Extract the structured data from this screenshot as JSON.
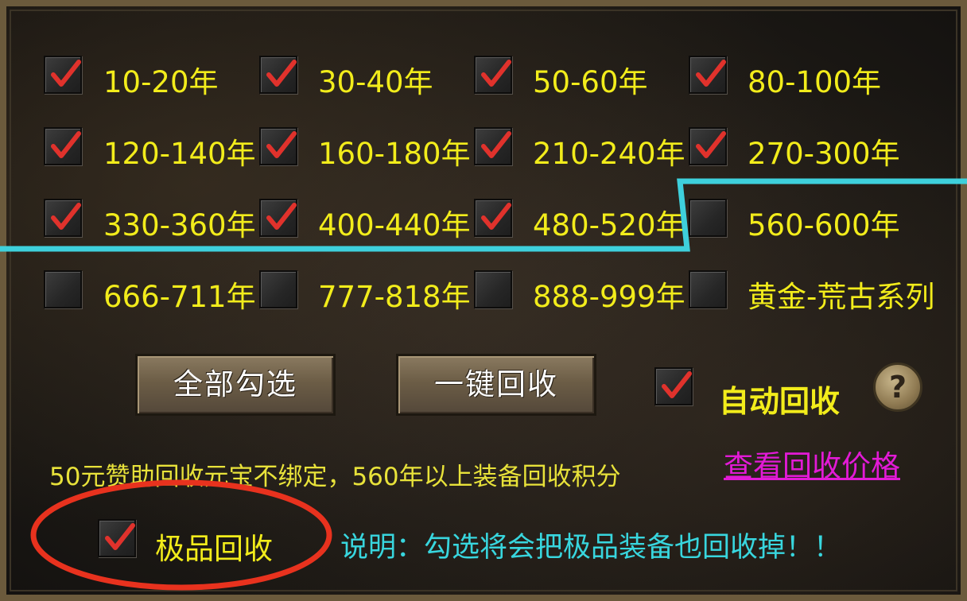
{
  "ranges": [
    {
      "label": "10-20年",
      "checked": true
    },
    {
      "label": "30-40年",
      "checked": true
    },
    {
      "label": "50-60年",
      "checked": true
    },
    {
      "label": "80-100年",
      "checked": true
    },
    {
      "label": "120-140年",
      "checked": true
    },
    {
      "label": "160-180年",
      "checked": true
    },
    {
      "label": "210-240年",
      "checked": true
    },
    {
      "label": "270-300年",
      "checked": true
    },
    {
      "label": "330-360年",
      "checked": true
    },
    {
      "label": "400-440年",
      "checked": true
    },
    {
      "label": "480-520年",
      "checked": true
    },
    {
      "label": "560-600年",
      "checked": false
    },
    {
      "label": "666-711年",
      "checked": false
    },
    {
      "label": "777-818年",
      "checked": false
    },
    {
      "label": "888-999年",
      "checked": false
    },
    {
      "label": "黄金-荒古系列",
      "checked": false
    }
  ],
  "buttons": {
    "select_all": "全部勾选",
    "one_click_recycle": "一键回收"
  },
  "auto_recycle": {
    "label": "自动回收",
    "checked": true
  },
  "help_icon_glyph": "?",
  "info_text": "50元赞助回收元宝不绑定，560年以上装备回收积分",
  "price_link": "查看回收价格",
  "premium_recycle": {
    "label": "极品回收",
    "checked": true
  },
  "note_text": "说明：勾选将会把极品装备也回收掉！！",
  "colors": {
    "label_yellow": "#f2ec1b",
    "link_magenta": "#e21ad6",
    "note_cyan": "#38d6de",
    "check_red": "#e0322c",
    "annotation_cyan": "#3ed0dc",
    "annotation_red": "#e8321e"
  }
}
